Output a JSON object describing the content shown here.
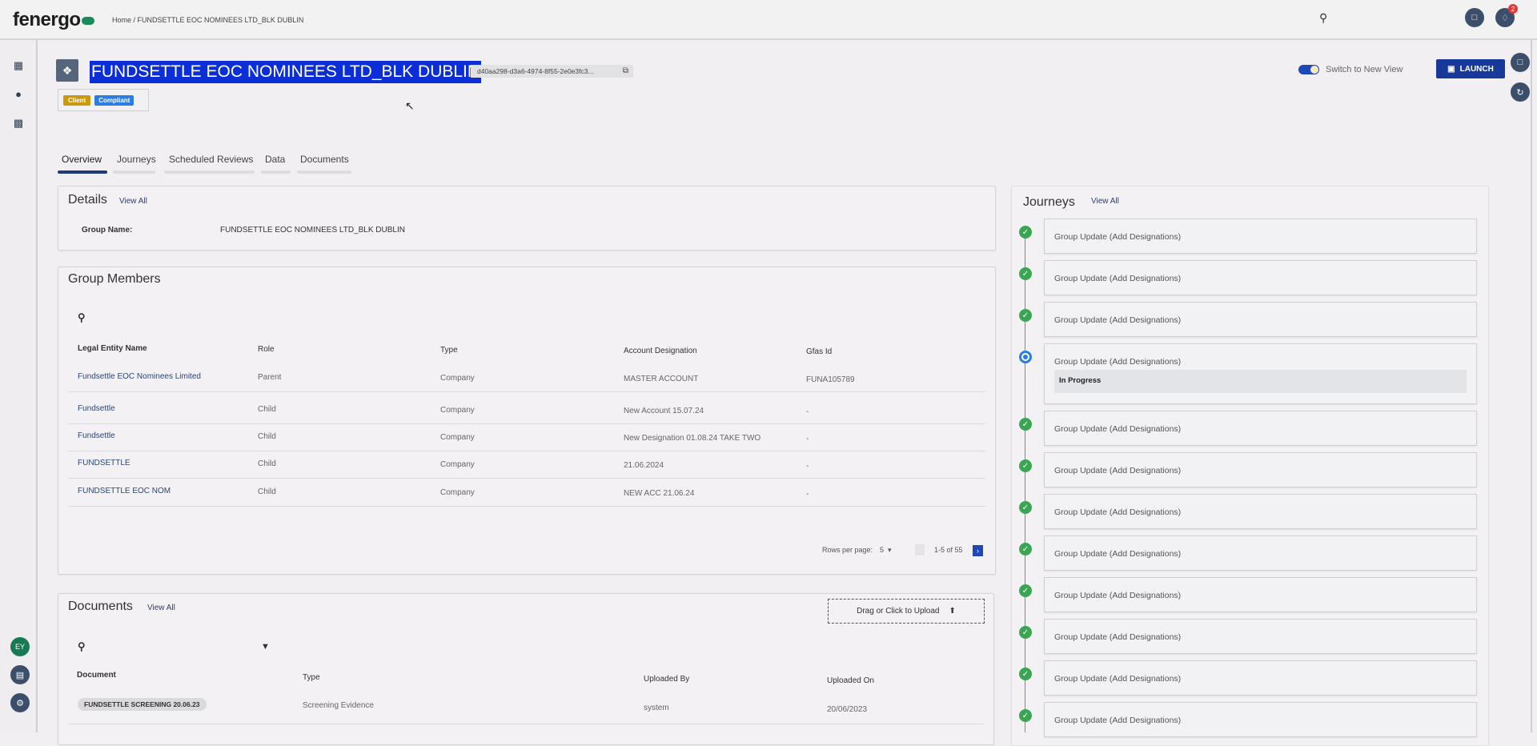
{
  "header": {
    "logo": "fenergo",
    "breadcrumb": "Home / FUNDSETTLE EOC NOMINEES LTD_BLK DUBLIN",
    "notification_count": "2"
  },
  "entity": {
    "title": "FUNDSETTLE EOC NOMINEES LTD_BLK DUBLIN",
    "id": "d40aa298-d3a6-4974-8f55-2e0e3fc3...",
    "badges": [
      "Client",
      "Compliant"
    ]
  },
  "actions": {
    "toggle_label": "Switch to New View",
    "toggle_on": true,
    "launch_label": "LAUNCH"
  },
  "tabs": [
    "Overview",
    "Journeys",
    "Scheduled Reviews",
    "Data",
    "Documents"
  ],
  "details": {
    "title": "Details",
    "view_all": "View All",
    "label": "Group Name:",
    "value": "FUNDSETTLE EOC NOMINEES LTD_BLK DUBLIN"
  },
  "group_members": {
    "title": "Group Members",
    "columns": [
      "Legal Entity Name",
      "Role",
      "Type",
      "Account Designation",
      "Gfas Id"
    ],
    "rows": [
      [
        "Fundsettle EOC Nominees Limited",
        "Parent",
        "Company",
        "MASTER ACCOUNT",
        "FUNA105789"
      ],
      [
        "Fundsettle",
        "Child",
        "Company",
        "New Account 15.07.24",
        "-"
      ],
      [
        "Fundsettle",
        "Child",
        "Company",
        "New Designation 01.08.24 TAKE TWO",
        "-"
      ],
      [
        "FUNDSETTLE",
        "Child",
        "Company",
        "21.06.2024",
        "-"
      ],
      [
        "FUNDSETTLE EOC NOM",
        "Child",
        "Company",
        "NEW ACC 21.06.24",
        "-"
      ]
    ],
    "rows_per_page_label": "Rows per page:",
    "rows_per_page": "5",
    "range": "1-5 of 55"
  },
  "documents": {
    "title": "Documents",
    "view_all": "View All",
    "upload_label": "Drag or Click to Upload",
    "columns": [
      "Document",
      "Type",
      "Uploaded By",
      "Uploaded On"
    ],
    "rows": [
      [
        "FUNDSETTLE SCREENING 20.06.23",
        "Screening Evidence",
        "system",
        "20/06/2023"
      ]
    ]
  },
  "journeys": {
    "title": "Journeys",
    "view_all": "View All",
    "in_progress_label": "In Progress",
    "items": [
      {
        "label": "Group Update (Add Designations)",
        "status": "done"
      },
      {
        "label": "Group Update (Add Designations)",
        "status": "done"
      },
      {
        "label": "Group Update (Add Designations)",
        "status": "done"
      },
      {
        "label": "Group Update (Add Designations)",
        "status": "in-progress"
      },
      {
        "label": "Group Update (Add Designations)",
        "status": "done"
      },
      {
        "label": "Group Update (Add Designations)",
        "status": "done"
      },
      {
        "label": "Group Update (Add Designations)",
        "status": "done"
      },
      {
        "label": "Group Update (Add Designations)",
        "status": "done"
      },
      {
        "label": "Group Update (Add Designations)",
        "status": "done"
      },
      {
        "label": "Group Update (Add Designations)",
        "status": "done"
      },
      {
        "label": "Group Update (Add Designations)",
        "status": "done"
      },
      {
        "label": "Group Update (Add Designations)",
        "status": "done"
      }
    ]
  },
  "user": {
    "initials": "EY"
  },
  "colors": {
    "brand": "#1b8a5a",
    "primary": "#17399a",
    "selection": "#0b2ed6",
    "client": "#c99a0e",
    "compliant": "#2a7de1",
    "done": "#3aa654",
    "progress": "#2a7de1"
  }
}
